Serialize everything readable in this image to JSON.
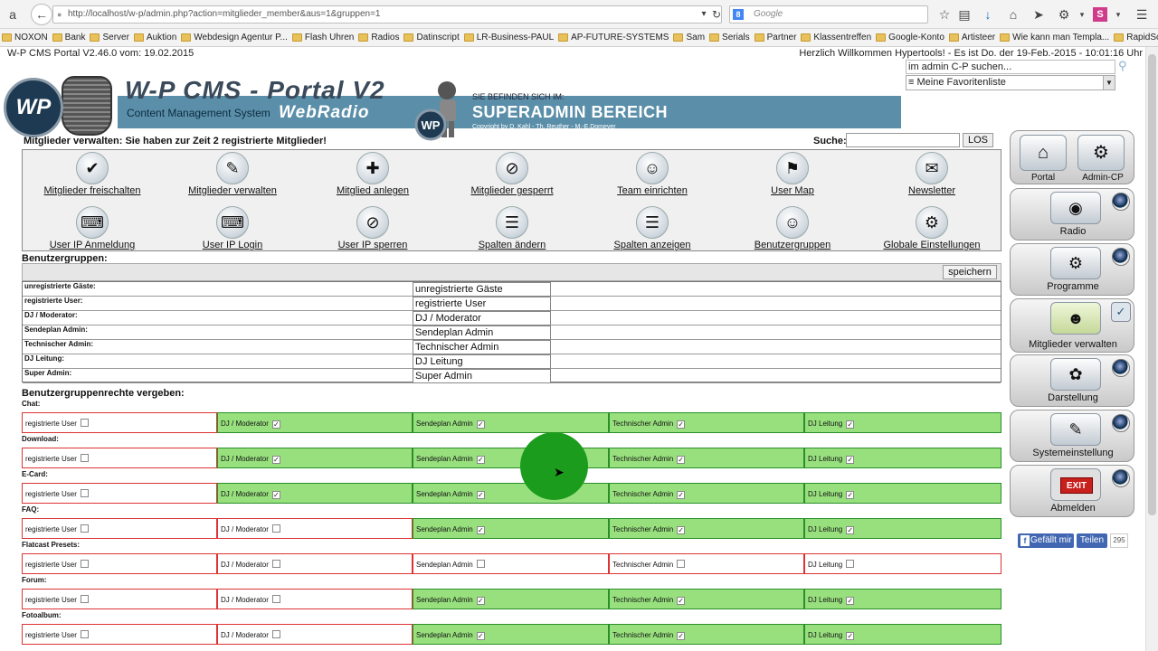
{
  "browser": {
    "url": "http://localhost/w-p/admin.php?action=mitglieder_member&aus=1&gruppen=1",
    "search_placeholder": "Google",
    "bookmarks": [
      "NOXON",
      "Bank",
      "Server",
      "Auktion",
      "Webdesign Agentur P...",
      "Flash Uhren",
      "Radios",
      "Datinscript",
      "LR-Business-PAUL",
      "AP-FUTURE-SYSTEMS",
      "Sam",
      "Serials",
      "Partner",
      "Klassentreffen",
      "Google-Konto",
      "Artisteer",
      "Wie kann man Templa...",
      "RapidSolution Software"
    ]
  },
  "header": {
    "version": "W-P CMS Portal V2.46.0 vom: 19.02.2015",
    "welcome": "Herzlich Willkommen Hypertools! - Es ist Do. der 19-Feb.-2015 - 10:01:16  Uhr",
    "logo_text": "WP",
    "logo_text_small": "WP",
    "title": "W-P CMS - Portal V2",
    "subtitle": "Content Management System",
    "webradio": "WebRadio",
    "you_are": "SIE BEFINDEN SICH IM:",
    "area": "SUPERADMIN BEREICH",
    "copyright": "Copyright by  D. Kahl  -  Th. Reuther  -  M.-E.Domeyer",
    "admin_search_value": "im admin C-P suchen...",
    "favorites_value": "≡ Meine Favoritenliste"
  },
  "main": {
    "heading": "Mitglieder verwalten: Sie haben zur Zeit 2 registrierte Mitglieder!",
    "search_label": "Suche:",
    "search_button": "LOS",
    "actions": [
      "Mitglieder freischalten",
      "Mitglieder verwalten",
      "Mitglied anlegen",
      "Mitglieder gesperrt",
      "Team einrichten",
      "User Map",
      "Newsletter",
      "User IP Anmeldung",
      "User IP Login",
      "User IP sperren",
      "Spalten ändern",
      "Spalten anzeigen",
      "Benutzergruppen",
      "Globale Einstellungen"
    ],
    "groups_heading": "Benutzergruppen:",
    "save_button": "speichern",
    "groups": [
      {
        "name": "unregistrierte Gäste:",
        "value": "unregistrierte Gäste"
      },
      {
        "name": "registrierte User:",
        "value": "registrierte User"
      },
      {
        "name": "DJ / Moderator:",
        "value": "DJ / Moderator"
      },
      {
        "name": "Sendeplan Admin:",
        "value": "Sendeplan Admin"
      },
      {
        "name": "Technischer Admin:",
        "value": "Technischer Admin"
      },
      {
        "name": "DJ Leitung:",
        "value": "DJ Leitung"
      },
      {
        "name": "Super Admin:",
        "value": "Super Admin"
      }
    ],
    "rights_heading": "Benutzergruppenrechte vergeben:",
    "role_labels": [
      "registrierte User",
      "DJ / Moderator",
      "Sendeplan Admin",
      "Technischer Admin",
      "DJ Leitung"
    ],
    "rights": [
      {
        "module": "Chat:",
        "checked": [
          false,
          true,
          true,
          true,
          true
        ]
      },
      {
        "module": "Download:",
        "checked": [
          false,
          true,
          true,
          true,
          true
        ]
      },
      {
        "module": "E-Card:",
        "checked": [
          false,
          true,
          true,
          true,
          true
        ]
      },
      {
        "module": "FAQ:",
        "checked": [
          false,
          false,
          true,
          true,
          true
        ]
      },
      {
        "module": "Flatcast Presets:",
        "checked": [
          false,
          false,
          false,
          false,
          false
        ]
      },
      {
        "module": "Forum:",
        "checked": [
          false,
          false,
          true,
          true,
          true
        ]
      },
      {
        "module": "Fotoalbum:",
        "checked": [
          false,
          false,
          true,
          true,
          true
        ]
      }
    ]
  },
  "sidebar": {
    "top_left": "Portal",
    "top_right": "Admin-CP",
    "items": [
      "Radio",
      "Programme",
      "Mitglieder verwalten",
      "Darstellung",
      "Systemeinstellung",
      "Abmelden"
    ],
    "exit_label": "EXIT"
  },
  "social": {
    "like": "Gefällt mir",
    "share": "Teilen",
    "count": "295"
  }
}
